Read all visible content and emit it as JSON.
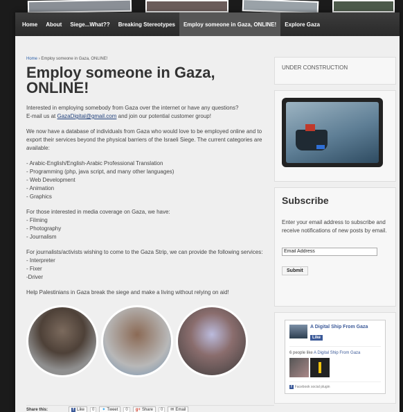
{
  "nav": {
    "items": [
      {
        "label": "Home"
      },
      {
        "label": "About"
      },
      {
        "label": "Siege...What??"
      },
      {
        "label": "Breaking Stereotypes"
      },
      {
        "label": "Employ someone in Gaza, ONLINE!"
      },
      {
        "label": "Explore Gaza"
      }
    ],
    "active_index": 4
  },
  "breadcrumb": {
    "home": "Home",
    "separator": "›",
    "current": "Employ someone in Gaza, ONLINE!"
  },
  "article": {
    "title": "Employ someone in Gaza, ONLINE!",
    "intro_line1": "Interested in employing somebody from Gaza over the internet or have any questions?",
    "intro_line2_prefix": "E-mail us at ",
    "intro_email": "GazaDigital@gmail.com",
    "intro_line2_suffix": " and join our potential customer group!",
    "database_para": "We now have a database of individuals from Gaza who would love to be employed online and to export their services beyond the physical barriers of the Israeli Siege. The current categories are available:",
    "categories": [
      "- Arabic-English/English-Arabic Professional Translation",
      "- Programming (php, java script, and many other languages)",
      "- Web Development",
      "- Animation",
      "- Graphics"
    ],
    "media_intro": "For those interested in media coverage on Gaza, we have:",
    "media_items": [
      "- Filming",
      "- Photography",
      "- Journalism"
    ],
    "journalist_intro": "For journalists/activists wishing to come to the Gaza Strip, we can provide the following services:",
    "journalist_items": [
      "- Interpreter",
      "- Fixer",
      "-Driver"
    ],
    "closing": "Help Palestinians in Gaza break the siege and make a living without relying on aid!"
  },
  "share": {
    "label": "Share this:",
    "like": "Like",
    "like_count": "0",
    "tweet": "Tweet",
    "tweet_count": "0",
    "share": "Share",
    "share_count": "0",
    "email": "Email"
  },
  "sidebar": {
    "under_construction": "UNDER CONSTRUCTION",
    "subscribe": {
      "title": "Subscribe",
      "text": "Enter your email address to subscribe and receive notifications of new posts by email.",
      "input_value": "Email Address",
      "button": "Submit"
    },
    "facebook": {
      "page_name": "A Digital Ship From Gaza",
      "like": "Like",
      "people_prefix": "6 people like ",
      "people_page": "A Digital Ship From Gaza",
      "plugin": "Facebook social plugin"
    }
  }
}
